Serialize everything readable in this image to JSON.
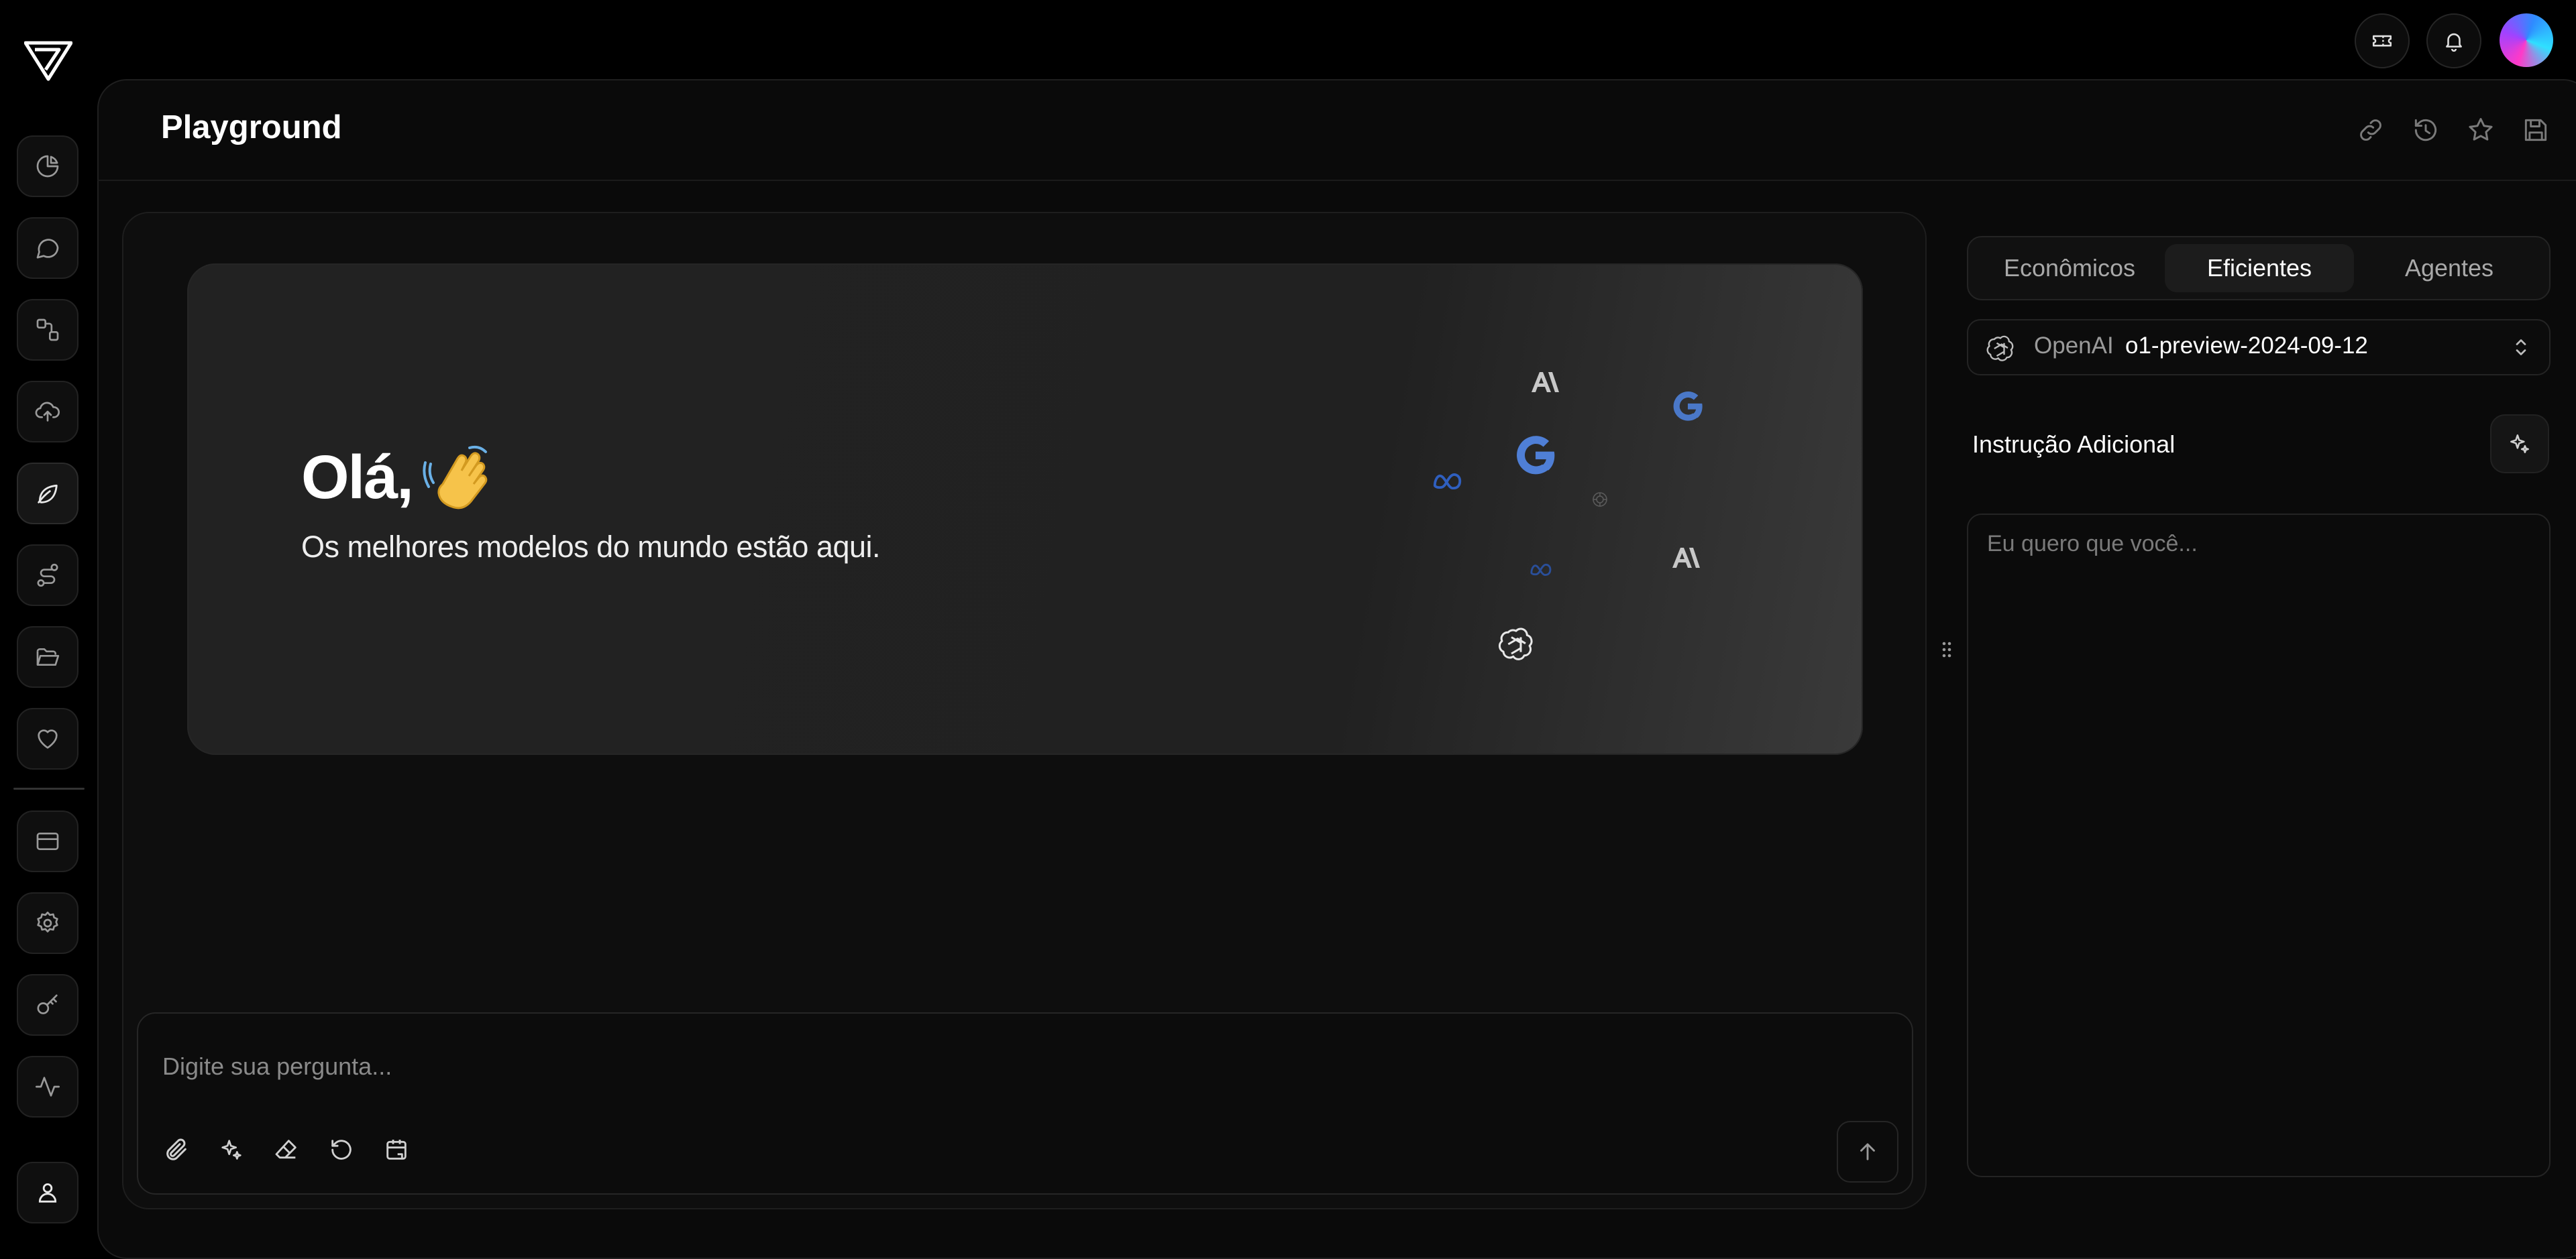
{
  "header": {
    "title": "Playground"
  },
  "sidebar": {
    "items": [
      {
        "icon": "pie-chart-icon"
      },
      {
        "icon": "chat-bubble-icon"
      },
      {
        "icon": "workflow-icon"
      },
      {
        "icon": "cloud-upload-icon"
      },
      {
        "icon": "leaf-icon",
        "active": true
      },
      {
        "icon": "route-icon"
      },
      {
        "icon": "folder-open-icon"
      },
      {
        "icon": "heart-icon"
      },
      {
        "icon": "credit-card-icon"
      },
      {
        "icon": "settings-gear-icon"
      },
      {
        "icon": "key-gear-icon"
      },
      {
        "icon": "activity-icon"
      },
      {
        "icon": "user-icon"
      }
    ]
  },
  "topbar": {
    "icons": [
      "ticket-icon",
      "bell-icon"
    ],
    "avatar_colors": [
      "#ff3ac8",
      "#a142ff",
      "#2f8bff",
      "#2fe0ff"
    ]
  },
  "header_actions": [
    "link-icon",
    "history-icon",
    "star-icon",
    "save-icon"
  ],
  "hero": {
    "greeting": "Olá,",
    "emoji": "👋",
    "subtitle": "Os melhores modelos do mundo estão aqui.",
    "logos": [
      "anthropic-logo",
      "google-logo",
      "meta-logo",
      "openai-logo"
    ]
  },
  "composer": {
    "placeholder": "Digite sua pergunta...",
    "tools": [
      "paperclip-icon",
      "sparkles-icon",
      "eraser-icon",
      "rotate-icon",
      "calendar-icon"
    ],
    "send_icon": "arrow-up-icon"
  },
  "model_panel": {
    "tabs": [
      {
        "label": "Econômicos",
        "active": false
      },
      {
        "label": "Eficientes",
        "active": true
      },
      {
        "label": "Agentes",
        "active": false
      }
    ],
    "selected_model": {
      "provider": "OpenAI",
      "name": "o1-preview-2024-09-12",
      "icon": "openai-logo"
    },
    "instruction_label": "Instrução Adicional",
    "instruction_placeholder": "Eu quero que você..."
  },
  "colors": {
    "background": "#000000",
    "panel": "#0e0e0e",
    "google_blue": "#4a78c8",
    "meta_blue": "#2f5fbf"
  }
}
